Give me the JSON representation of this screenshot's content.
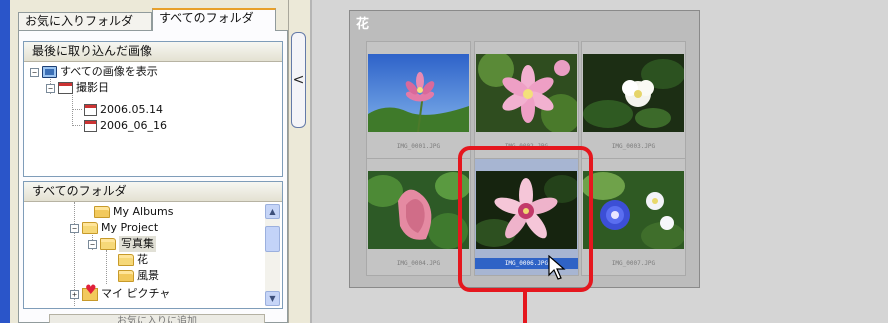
{
  "left_panel": {
    "tabs": [
      "お気に入りフォルダ",
      "すべてのフォルダ"
    ],
    "active_tab": 1,
    "recent_section": {
      "header": "最後に取り込んだ画像",
      "items": {
        "show_all": "すべての画像を表示",
        "shooting_date": "撮影日",
        "date1": "2006.05.14",
        "date2": "2006_06_16"
      }
    },
    "folder_section": {
      "header": "すべてのフォルダ",
      "items": {
        "my_albums": "My Albums",
        "my_project": "My Project",
        "photo_collection": "写真集",
        "flower": "花",
        "landscape": "風景",
        "my_pictures": "マイ ピクチャ"
      }
    },
    "add_favorite_button": "お気に入りに追加"
  },
  "content": {
    "album_title": "花",
    "thumbnails": [
      {
        "caption": "IMG_0001.JPG",
        "selected": false
      },
      {
        "caption": "IMG_0002.JPG",
        "selected": false
      },
      {
        "caption": "IMG_0003.JPG",
        "selected": false
      },
      {
        "caption": "IMG_0004.JPG",
        "selected": false
      },
      {
        "caption": "IMG_0006.JPG",
        "selected": true
      },
      {
        "caption": "IMG_0007.JPG",
        "selected": false
      }
    ]
  },
  "colors": {
    "highlight": "#e5171e",
    "selection": "#2f63c6",
    "tab_accent": "#e8a02a"
  }
}
